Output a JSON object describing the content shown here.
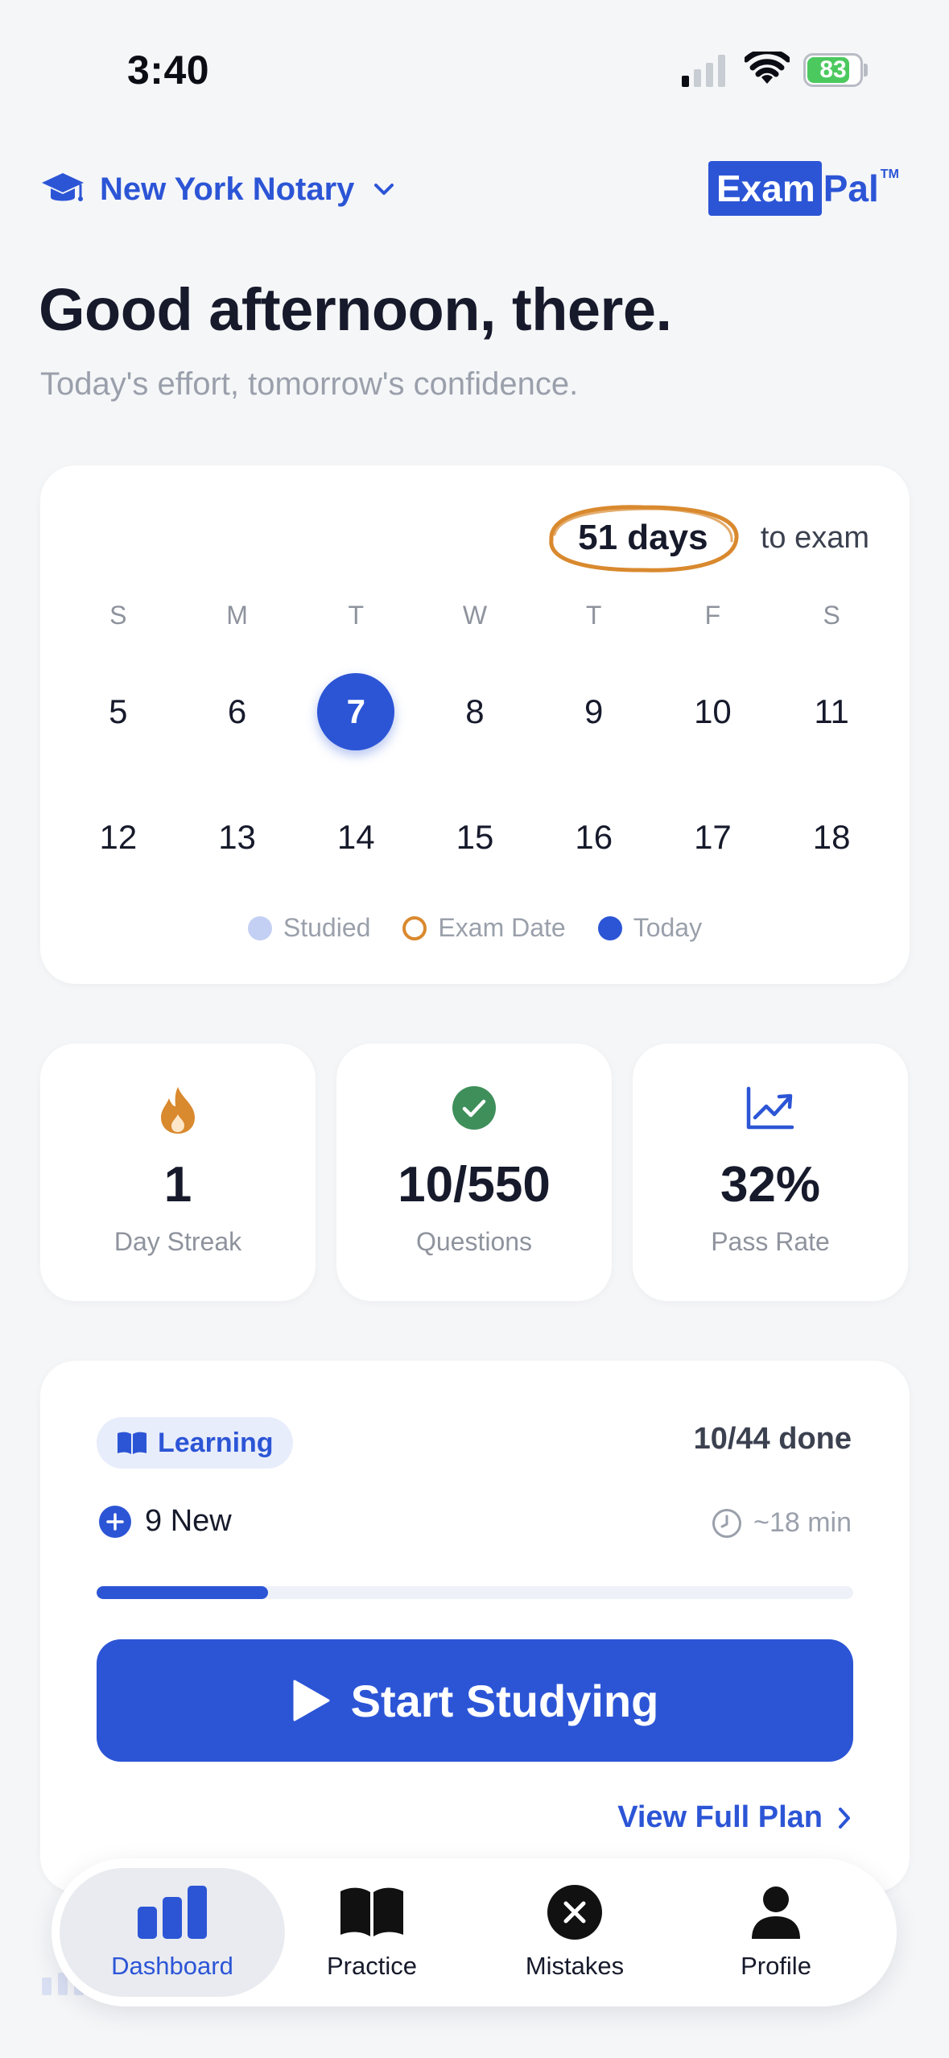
{
  "status": {
    "time": "3:40",
    "battery": "83",
    "battery_level": 0.83
  },
  "header": {
    "exam_name": "New York Notary",
    "logo_exam": "Exam",
    "logo_pal": "Pal",
    "logo_tm": "TM"
  },
  "greeting": {
    "title": "Good afternoon, there.",
    "subtitle": "Today's effort, tomorrow's confidence."
  },
  "calendar": {
    "countdown_value": "51 days",
    "countdown_suffix": "to exam",
    "weekdays": [
      "S",
      "M",
      "T",
      "W",
      "T",
      "F",
      "S"
    ],
    "week1": [
      "5",
      "6",
      "7",
      "8",
      "9",
      "10",
      "11"
    ],
    "week2": [
      "12",
      "13",
      "14",
      "15",
      "16",
      "17",
      "18"
    ],
    "today": "7",
    "legend": {
      "studied": "Studied",
      "exam_date": "Exam Date",
      "today": "Today"
    }
  },
  "stats": {
    "streak": {
      "value": "1",
      "label": "Day Streak"
    },
    "questions": {
      "value": "10/550",
      "label": "Questions"
    },
    "pass_rate": {
      "value": "32%",
      "label": "Pass Rate"
    }
  },
  "learning": {
    "tag": "Learning",
    "done": "10/44 done",
    "new_count": "9 New",
    "time_estimate": "~18 min",
    "progress": 0.227,
    "start_label": "Start Studying",
    "view_plan_label": "View Full Plan"
  },
  "tabs": {
    "dashboard": "Dashboard",
    "practice": "Practice",
    "mistakes": "Mistakes",
    "profile": "Profile"
  },
  "colors": {
    "accent": "#2c55d6",
    "exam_orange": "#d9892e",
    "success": "#3f8f5a",
    "battery": "#4cc95e"
  }
}
